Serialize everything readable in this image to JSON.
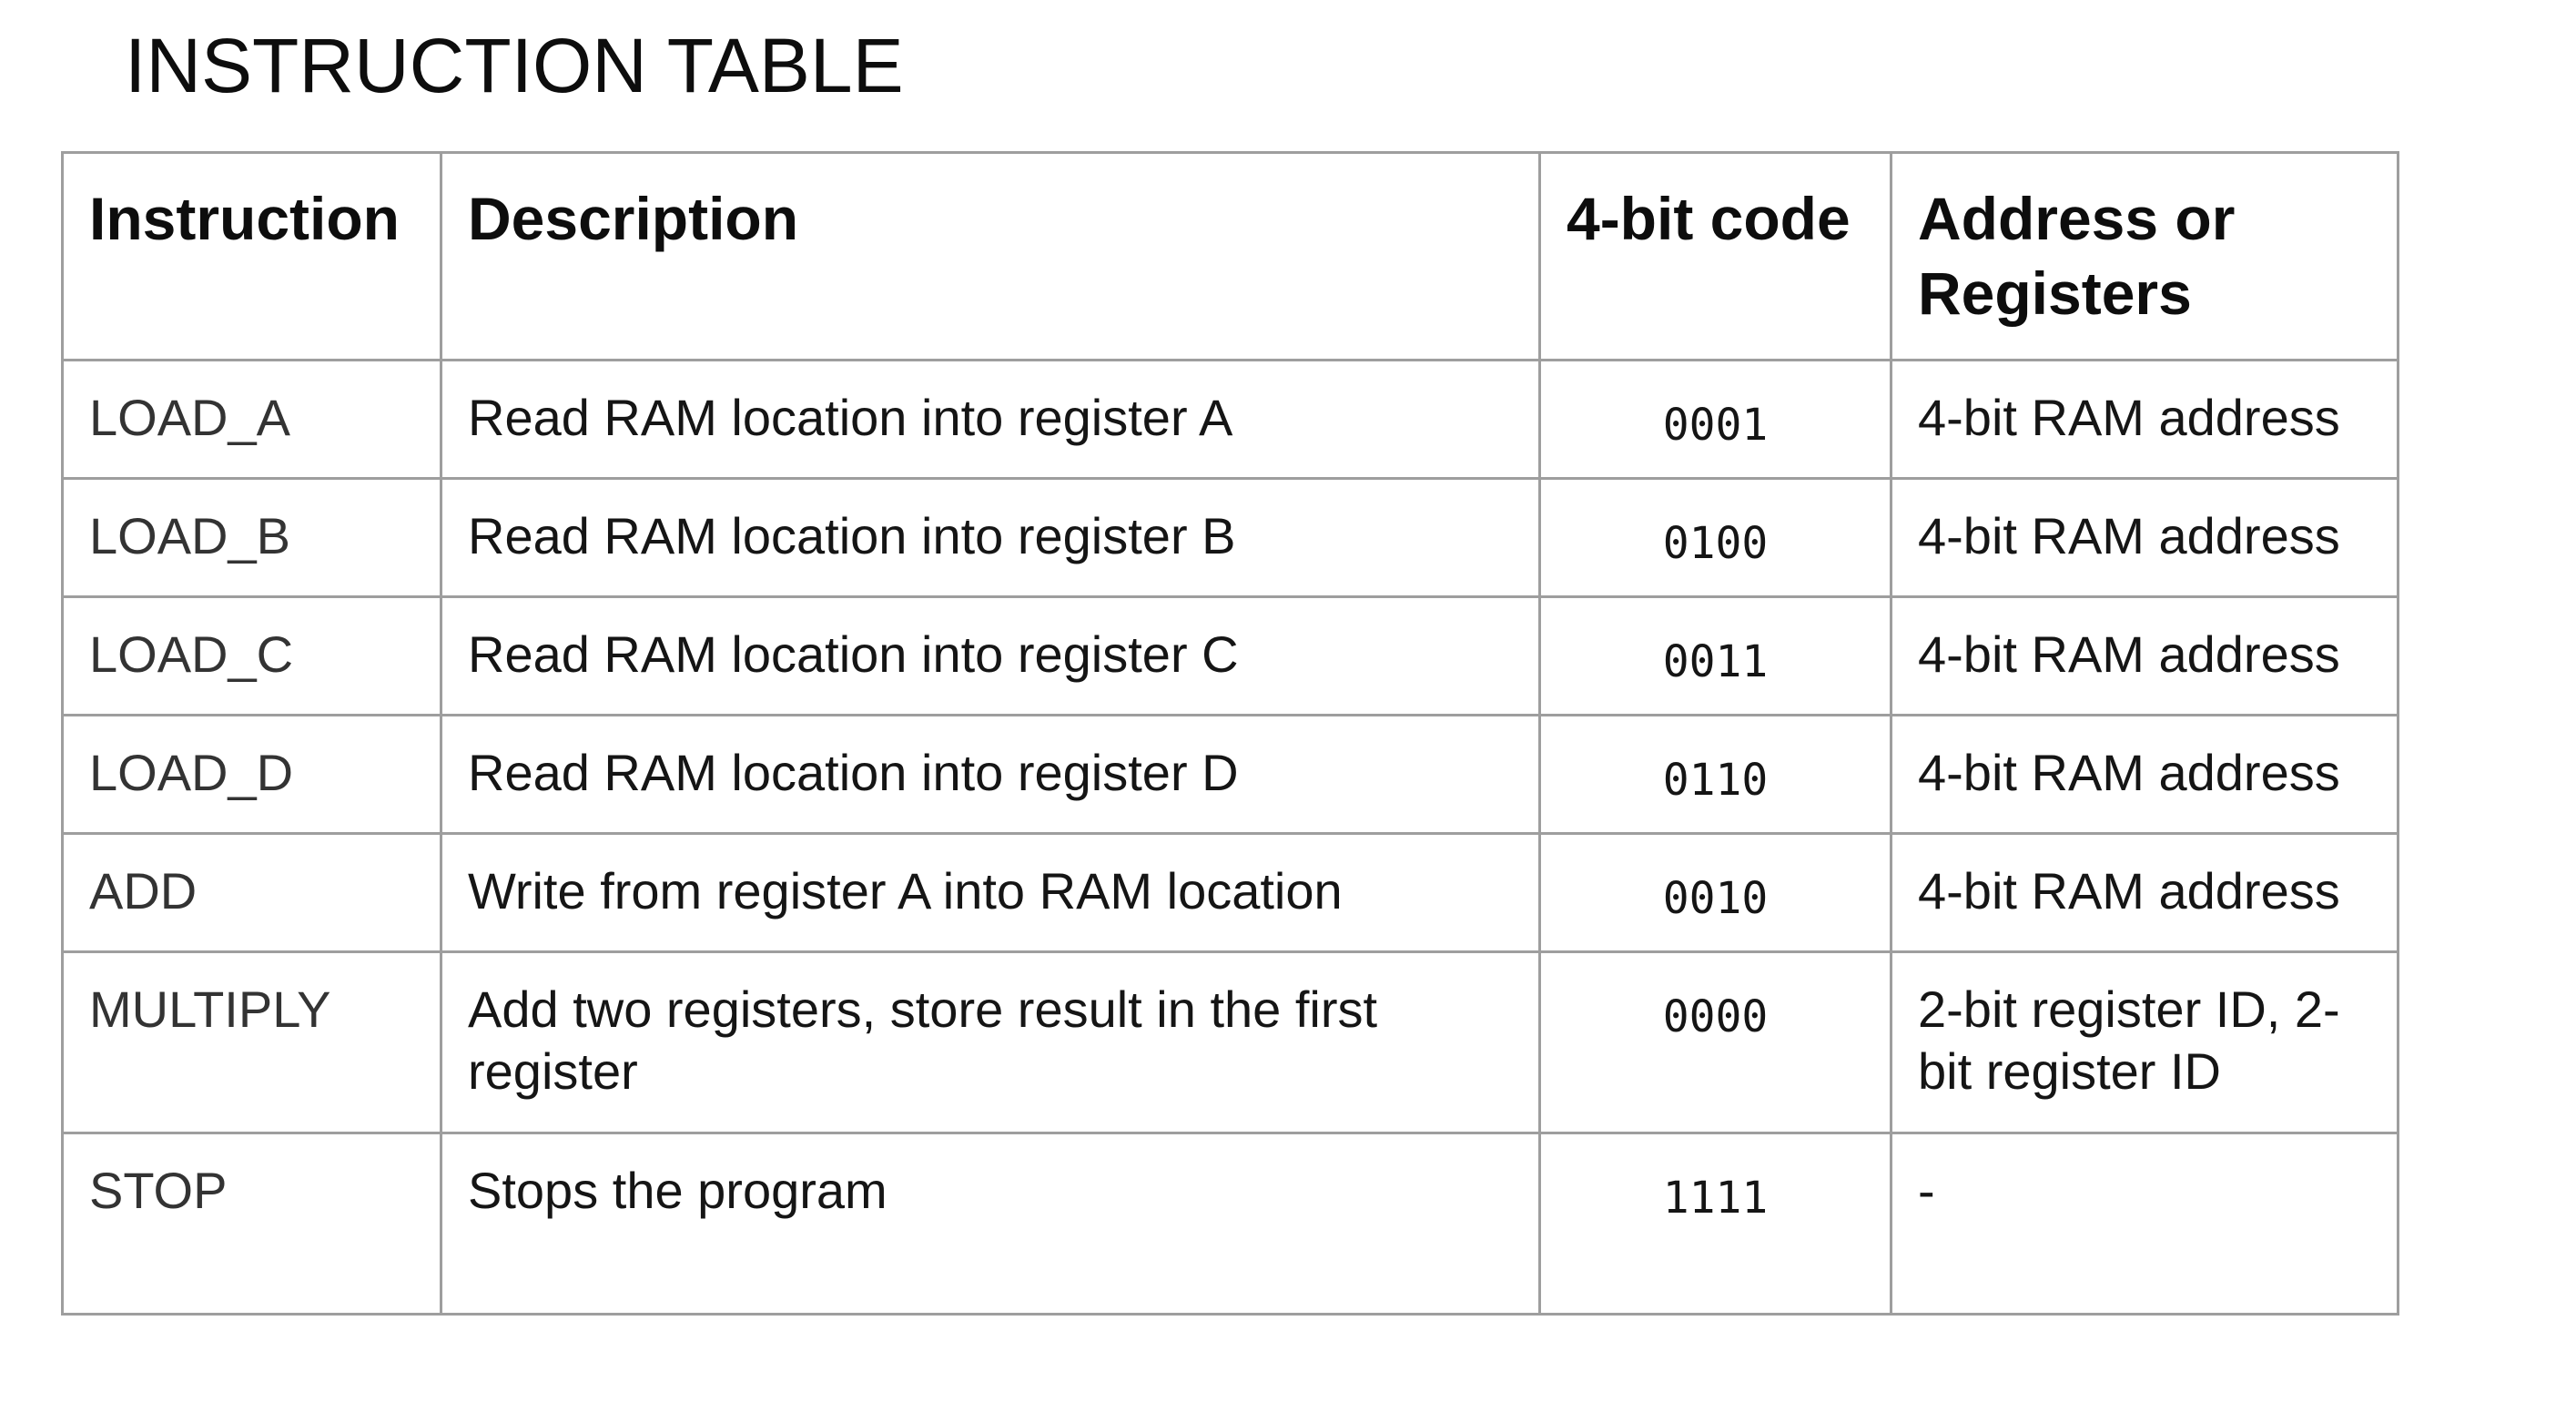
{
  "title": "INSTRUCTION TABLE",
  "columns": {
    "instruction": "Instruction",
    "description": "Description",
    "code": "4-bit code",
    "operand": "Address or Registers"
  },
  "rows": [
    {
      "instruction": "LOAD_A",
      "description": "Read RAM location into register A",
      "code": "0001",
      "operand": "4-bit RAM address"
    },
    {
      "instruction": "LOAD_B",
      "description": "Read RAM location into register B",
      "code": "0100",
      "operand": "4-bit RAM address"
    },
    {
      "instruction": "LOAD_C",
      "description": "Read RAM location into register C",
      "code": "0011",
      "operand": "4-bit RAM address"
    },
    {
      "instruction": "LOAD_D",
      "description": "Read RAM location into register D",
      "code": "0110",
      "operand": "4-bit RAM address"
    },
    {
      "instruction": "ADD",
      "description": "Write from register A into RAM location",
      "code": "0010",
      "operand": "4-bit RAM address"
    },
    {
      "instruction": "MULTIPLY",
      "description": "Add two registers, store result in the first register",
      "code": "0000",
      "operand": "2-bit register ID, 2-bit register ID"
    },
    {
      "instruction": "STOP",
      "description": "Stops the program",
      "code": "1111",
      "operand": "-"
    }
  ]
}
